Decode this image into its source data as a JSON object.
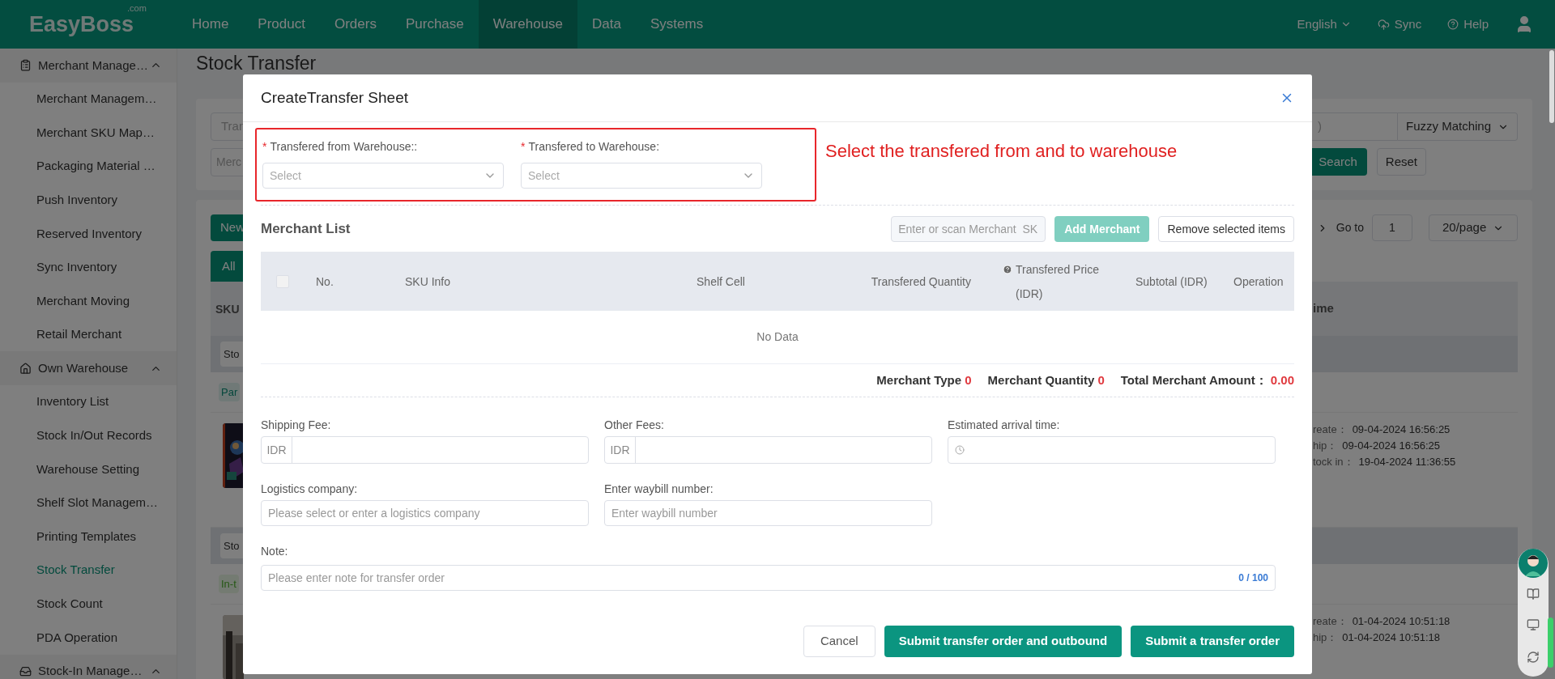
{
  "header": {
    "logo": "EasyBoss",
    "logo_suffix": ".com",
    "nav": [
      {
        "label": "Home",
        "selected": false
      },
      {
        "label": "Product",
        "selected": false
      },
      {
        "label": "Orders",
        "selected": false
      },
      {
        "label": "Purchase",
        "selected": false
      },
      {
        "label": "Warehouse",
        "selected": true
      },
      {
        "label": "Data",
        "selected": false
      },
      {
        "label": "Systems",
        "selected": false
      }
    ],
    "language": "English",
    "sync": "Sync",
    "help": "Help"
  },
  "sidebar": {
    "groups": [
      {
        "label": "Merchant Manage…",
        "kind": "clipboard",
        "expanded": true,
        "children": [
          {
            "label": "Merchant Managem…",
            "selected": false
          },
          {
            "label": "Merchant SKU Map…",
            "selected": false
          },
          {
            "label": "Packaging Material …",
            "selected": false
          },
          {
            "label": "Push Inventory",
            "selected": false
          },
          {
            "label": "Reserved Inventory",
            "selected": false
          },
          {
            "label": "Sync Inventory",
            "selected": false
          },
          {
            "label": "Merchant Moving",
            "selected": false
          },
          {
            "label": "Retail Merchant",
            "selected": false
          }
        ]
      },
      {
        "label": "Own Warehouse",
        "kind": "house",
        "expanded": true,
        "children": [
          {
            "label": "Inventory List",
            "selected": false
          },
          {
            "label": "Stock In/Out Records",
            "selected": false
          },
          {
            "label": "Warehouse Setting",
            "selected": false
          },
          {
            "label": "Shelf Slot Managem…",
            "selected": false
          },
          {
            "label": "Printing Templates",
            "selected": false
          },
          {
            "label": "Stock Transfer",
            "selected": true
          },
          {
            "label": "Stock Count",
            "selected": false
          },
          {
            "label": "PDA Operation",
            "selected": false
          }
        ]
      },
      {
        "label": "Stock-In Manage…",
        "kind": "inbox",
        "expanded": true
      }
    ]
  },
  "page": {
    "title": "Stock Transfer",
    "filter": {
      "left_inputs": [
        "Tran",
        "Merc"
      ],
      "right_input": ")",
      "match_select": "Fuzzy Matching",
      "search": "Search",
      "reset": "Reset"
    },
    "list": {
      "new_button": "New",
      "goto_label": "Go to",
      "goto_value": "1",
      "page_size": "20/page",
      "tab": "All",
      "sku_header": "SKU",
      "time_header": "ime",
      "groups": [
        {
          "select": "Sto",
          "tag": "Par",
          "kind": "partial",
          "dates": [
            {
              "label": "reate：",
              "value": "09-04-2024 16:56:25"
            },
            {
              "label": "hip：",
              "value": "09-04-2024 16:56:25"
            },
            {
              "label": "tock in：",
              "value": "19-04-2024 11:36:55"
            }
          ]
        },
        {
          "select": "Sto",
          "tag": "In-t",
          "kind": "transit",
          "dates": [
            {
              "label": "reate：",
              "value": "01-04-2024 10:51:18"
            },
            {
              "label": "hip：",
              "value": "01-04-2024 10:51:18"
            }
          ]
        }
      ]
    }
  },
  "modal": {
    "title": "CreateTransfer Sheet",
    "annotation": "Select the transfered from and to warehouse",
    "warehouse_fields": [
      {
        "marker": "*",
        "label": "Transfered from Warehouse::",
        "placeholder": "Select"
      },
      {
        "marker": "*",
        "label": "Transfered to Warehouse:",
        "placeholder": "Select"
      }
    ],
    "merchant_list": {
      "title": "Merchant List",
      "scan_placeholder": "Enter or scan Merchant  SK",
      "add_button": "Add Merchant",
      "add_disabled": true,
      "remove_button": "Remove selected items",
      "select_all_checked": false,
      "columns": [
        {
          "label": "No.",
          "kind": "plain"
        },
        {
          "label": "SKU Info",
          "kind": "plain"
        },
        {
          "label": "Shelf Cell",
          "kind": "plain"
        },
        {
          "label": "Transfered Quantity",
          "kind": "plain"
        },
        {
          "label": "Transfered Price (IDR)",
          "kind": "help"
        },
        {
          "label": "Subtotal (IDR)",
          "kind": "plain"
        },
        {
          "label": "Operation",
          "kind": "plain"
        }
      ],
      "empty_text": "No Data"
    },
    "summary": [
      {
        "label": "Merchant Type",
        "value": "0"
      },
      {
        "label": "Merchant Quantity",
        "value": "0"
      },
      {
        "label": "Total Merchant Amount：",
        "value": "0.00"
      }
    ],
    "fields": [
      {
        "label": "Shipping Fee:",
        "kind": "currency",
        "prefix": "IDR"
      },
      {
        "label": "Other Fees:",
        "kind": "currency",
        "prefix": "IDR"
      },
      {
        "label": "Estimated arrival time:",
        "kind": "time"
      },
      {
        "label": "Logistics company:",
        "kind": "text",
        "placeholder": "Please select or enter a logistics company"
      },
      {
        "label": "Enter waybill number:",
        "kind": "text",
        "placeholder": "Enter waybill number"
      },
      {
        "label": "Note:",
        "kind": "note",
        "placeholder": "Please enter note for transfer order",
        "counter": "0 / 100"
      }
    ],
    "buttons": [
      {
        "label": "Cancel",
        "kind": "secondary"
      },
      {
        "label": "Submit transfer order and outbound",
        "kind": "primary"
      },
      {
        "label": "Submit a transfer order",
        "kind": "primary"
      }
    ]
  }
}
